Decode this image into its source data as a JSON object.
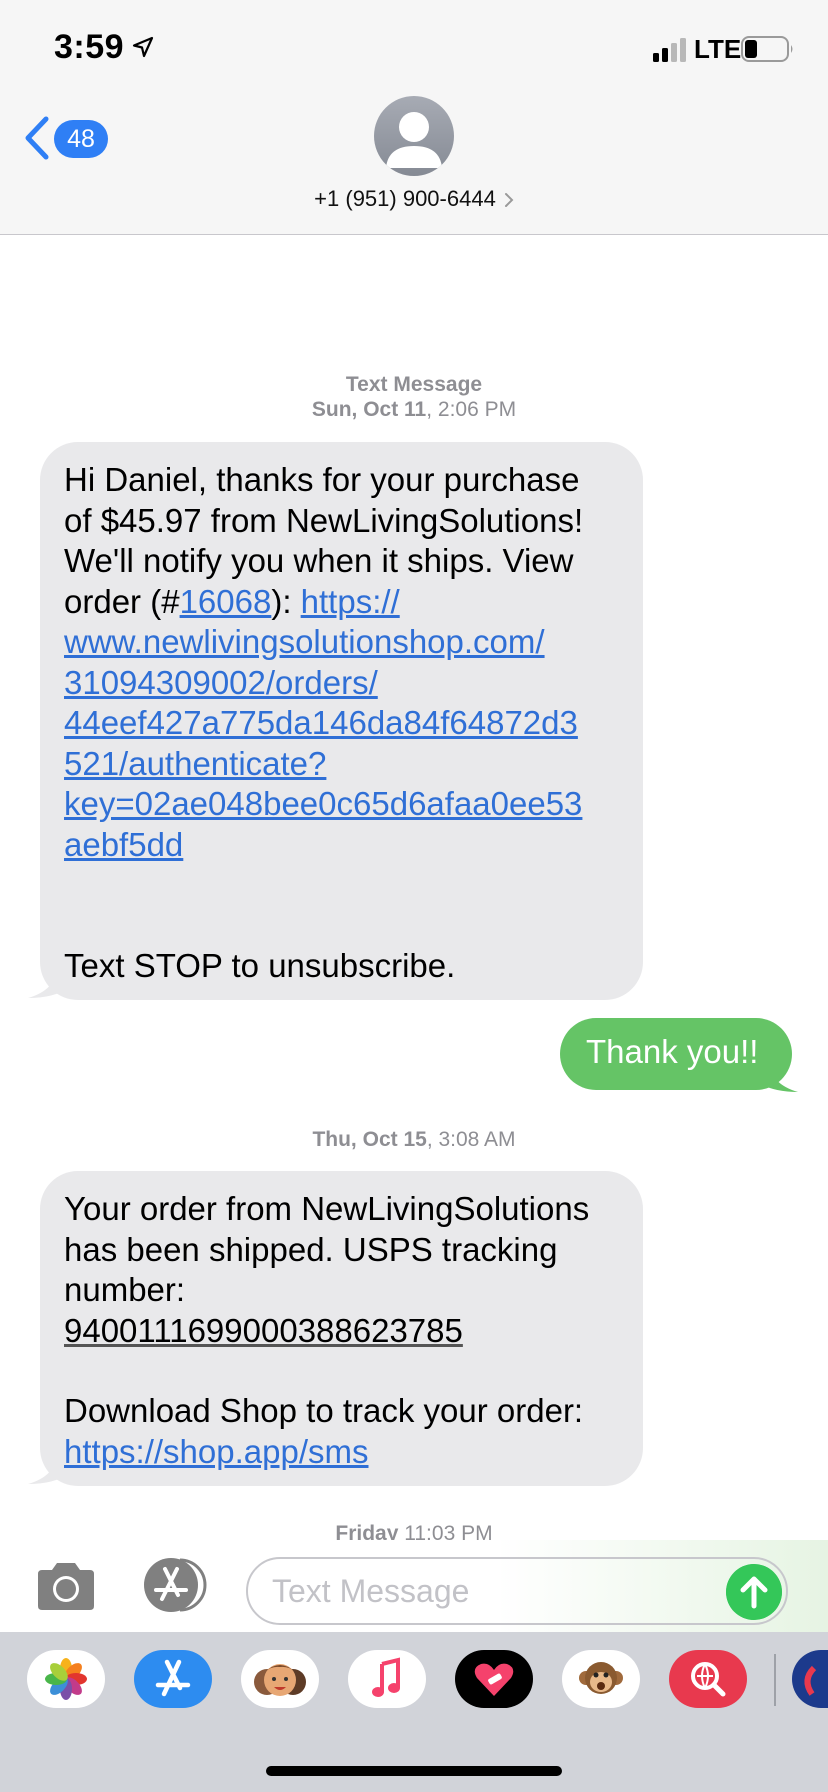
{
  "status_bar": {
    "time": "3:59",
    "network": "LTE"
  },
  "header": {
    "back_badge": "48",
    "contact": "+1 (951) 900-6444"
  },
  "thread": {
    "ts1_label": "Text Message",
    "ts1_day": "Sun, Oct 11",
    "ts1_time": ", 2:06 PM",
    "msg1": {
      "lines": [
        "Hi Daniel, thanks for your purchase",
        "of $45.97 from NewLivingSolutions!",
        "We'll notify you when it ships. View"
      ],
      "order_prefix": "order (#",
      "order_number": "16068",
      "order_suffix": "): ",
      "link_lines": [
        "https://",
        "www.newlivingsolutionshop.com/",
        "31094309002/orders/",
        "44eef427a775da146da84f64872d3",
        "521/authenticate?",
        "key=02ae048bee0c65d6afaa0ee53",
        "aebf5dd"
      ],
      "footer": "Text STOP to unsubscribe."
    },
    "msg2": {
      "text": "Thank you!!"
    },
    "ts2_day": "Thu, Oct 15",
    "ts2_time": ", 3:08 AM",
    "msg3": {
      "lines": [
        "Your order from NewLivingSolutions",
        "has been shipped. USPS tracking",
        "number:"
      ],
      "tracking": "9400111699000388623785",
      "download": "Download Shop to track your order:",
      "link": "https://shop.app/sms"
    },
    "ts3_day": "Friday",
    "ts3_time": " 11:03 PM"
  },
  "input": {
    "placeholder": "Text Message"
  },
  "app_drawer": {
    "apps": [
      "photos-icon",
      "app-store-icon",
      "memoji-icon",
      "music-icon",
      "heart-app-icon",
      "monkey-animoji-icon",
      "search-web-icon",
      "partial-app-icon"
    ]
  },
  "colors": {
    "incoming_bubble": "#e9e9eb",
    "outgoing_bubble": "#65c466",
    "link": "#2f6fd6",
    "badge": "#2f7ff5"
  }
}
